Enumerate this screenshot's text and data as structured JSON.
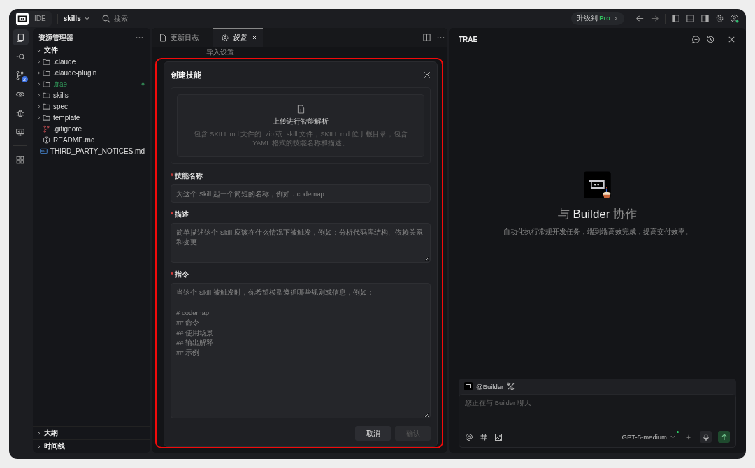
{
  "titlebar": {
    "product": "IDE",
    "project": "skills",
    "search": {
      "placeholder": "搜索"
    },
    "upgrade": "升级到 **Pro**"
  },
  "activity_bar": [
    {
      "kind": "explorer",
      "selected": true
    },
    {
      "kind": "search",
      "selected": false
    },
    {
      "kind": "source-control",
      "selected": false,
      "badge": "2"
    },
    {
      "kind": "preview",
      "selected": false
    },
    {
      "kind": "debug",
      "selected": false
    },
    {
      "kind": "remote",
      "selected": false
    },
    {
      "kind": "extensions",
      "selected": false
    }
  ],
  "sidebar": {
    "title": "资源管理器",
    "sections": [
      {
        "label": "文件",
        "expanded": true,
        "children": [
          {
            "name": ".claude",
            "kind": "folder",
            "modified": false
          },
          {
            "name": ".claude-plugin",
            "kind": "folder",
            "modified": false
          },
          {
            "name": ".trae",
            "kind": "folder",
            "modified": true
          },
          {
            "name": "skills",
            "kind": "folder",
            "modified": false
          },
          {
            "name": "spec",
            "kind": "folder",
            "modified": false
          },
          {
            "name": "template",
            "kind": "folder",
            "modified": false
          },
          {
            "name": ".gitignore",
            "kind": "git",
            "modified": false
          },
          {
            "name": "README.md",
            "kind": "info",
            "modified": false
          },
          {
            "name": "THIRD_PARTY_NOTICES.md",
            "kind": "markdown",
            "modified": false
          }
        ]
      },
      {
        "label": "大纲",
        "expanded": false
      },
      {
        "label": "时间线",
        "expanded": false
      }
    ]
  },
  "editor": {
    "tabs": [
      {
        "label": "更新日志",
        "kind": "file",
        "selected": false
      },
      {
        "label": "设置",
        "kind": "settings",
        "selected": true
      }
    ],
    "background_text": "导入设置",
    "dialog": {
      "title": "创建技能",
      "upload": {
        "title": "上传进行智能解析",
        "hint": "包含 SKILL.md 文件的 .zip 或 .skill 文件，SKILL.md 位于根目录，包含 YAML 格式的技能名称和描述。"
      },
      "fields": [
        {
          "label": "技能名称",
          "required_mark": "*",
          "kind": "input",
          "placeholder": "为这个 Skill 起一个简短的名称，例如：codemap"
        },
        {
          "label": "描述",
          "required_mark": "*",
          "kind": "textarea",
          "placeholder": "简单描述这个 Skill 应该在什么情况下被触发，例如：分析代码库结构、依赖关系和变更"
        },
        {
          "label": "指令",
          "required_mark": "*",
          "kind": "tall-textarea",
          "placeholder": "当这个 Skill 被触发时，你希望模型遵循哪些规则或信息，例如：\n\n# codemap\n## 命令\n## 使用场景\n## 输出解释\n## 示例"
        }
      ],
      "buttons": [
        {
          "label": "取消",
          "disabled": false
        },
        {
          "label": "确认",
          "disabled": true
        }
      ]
    }
  },
  "chat": {
    "title": "TRAE",
    "welcome": {
      "heading": "与 **Builder** 协作",
      "subtitle": "自动化执行常规开发任务，端到端高效完成，提高交付效率。"
    },
    "input": {
      "agent": "@Builder",
      "placeholder": "您正在与 Builder 聊天",
      "model": "GPT-5-medium"
    }
  }
}
